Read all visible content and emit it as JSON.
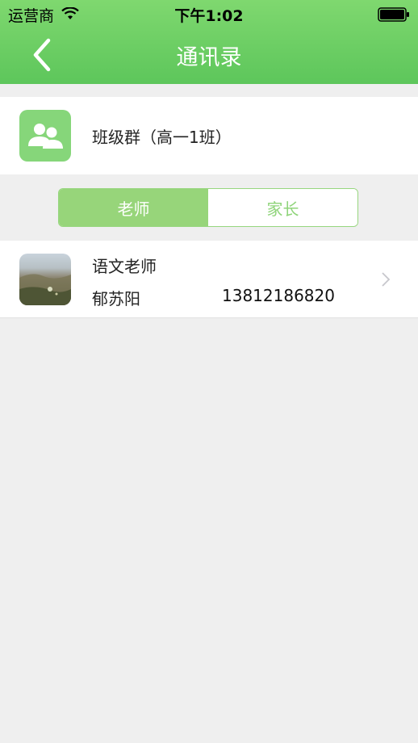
{
  "status_bar": {
    "carrier": "运营商",
    "time": "下午1:02"
  },
  "nav": {
    "title": "通讯录",
    "back_icon": "chevron-left-icon"
  },
  "group": {
    "icon": "group-users-icon",
    "label": "班级群（高一1班）"
  },
  "segmented_control": {
    "tabs": [
      {
        "label": "老师",
        "selected": true
      },
      {
        "label": "家长",
        "selected": false
      }
    ]
  },
  "contacts": [
    {
      "role": "语文老师",
      "name": "郁苏阳",
      "phone": "13812186820",
      "avatar": "landscape-photo"
    }
  ],
  "colors": {
    "accent_green": "#5dc65b",
    "segment_green": "#97d57a",
    "background": "#efefef"
  }
}
